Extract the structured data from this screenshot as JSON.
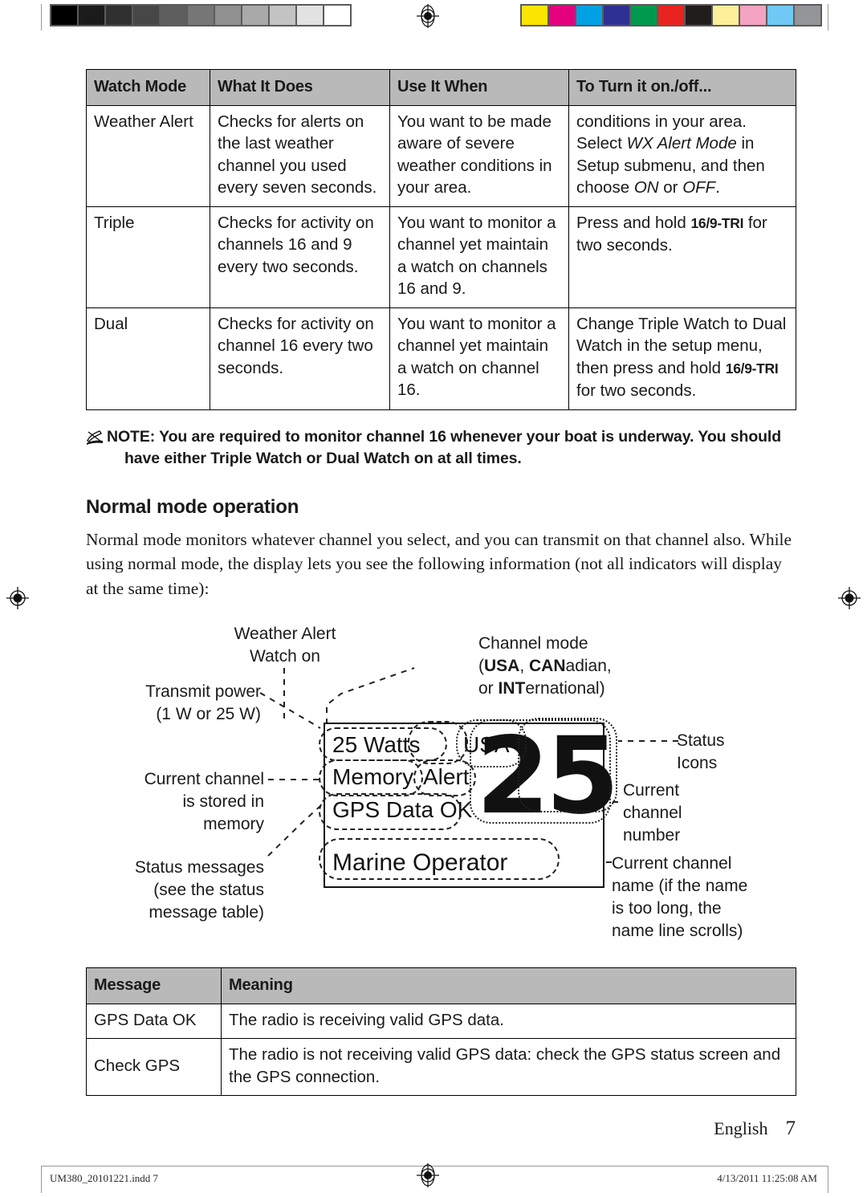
{
  "print_marks": {
    "gray_swatches": [
      "#000000",
      "#1b1b1b",
      "#303030",
      "#474747",
      "#5e5e5e",
      "#767676",
      "#909090",
      "#a9a9a9",
      "#c3c3c3",
      "#e2e2e2",
      "#ffffff"
    ],
    "color_swatches": [
      "#fbe400",
      "#e5007e",
      "#00a0e4",
      "#2e3192",
      "#009a4e",
      "#e8231f",
      "#211d1c",
      "#fdf09a",
      "#f4a3c2",
      "#6fc9f4",
      "#939598"
    ],
    "registration_icon": "registration-target-icon"
  },
  "watch_table": {
    "headers": [
      "Watch Mode",
      "What It Does",
      "Use It When",
      "To Turn it on./off..."
    ],
    "rows": [
      {
        "mode": "Weather Alert",
        "what": "Checks for alerts on the last weather channel you used every seven seconds.",
        "when": "You want to be made aware of severe weather conditions in your area.",
        "howto_pre": "conditions in your area. Select ",
        "howto_italic1": "WX Alert Mode",
        "howto_mid": " in Setup submenu, and then choose ",
        "howto_italic2": "ON",
        "howto_mid2": " or ",
        "howto_italic3": "OFF",
        "howto_post": "."
      },
      {
        "mode": "Triple",
        "what": "Checks for activity on channels 16 and 9 every two seconds.",
        "when": "You want to monitor a channel yet maintain a watch on channels 16 and 9.",
        "howto_pre": "Press and hold ",
        "howto_key": "16/9-TRI",
        "howto_post": " for two seconds."
      },
      {
        "mode": "Dual",
        "what": "Checks for activity on channel 16 every two seconds.",
        "when": "You want to monitor a channel yet maintain a watch on channel 16.",
        "howto_pre": "Change Triple Watch to Dual Watch in the setup menu, then press and hold ",
        "howto_key": "16/9-TRI",
        "howto_post": " for two seconds."
      }
    ]
  },
  "note": {
    "icon": "pencil-note-icon",
    "line1": "NOTE: You are required to monitor channel 16 whenever your boat is underway. You should",
    "line2": "have either Triple Watch or Dual Watch on at all times."
  },
  "section": {
    "title": "Normal mode operation",
    "paragraph": "Normal mode monitors whatever channel you select, and you can transmit on that channel also. While using normal mode, the display lets you see the following information (not all indicators will display at the same time):"
  },
  "diagram": {
    "callouts": {
      "weather_alert_l1": "Weather Alert",
      "weather_alert_l2": "Watch on",
      "channel_mode_l1": "Channel mode",
      "channel_mode_l2_a": "(",
      "channel_mode_l2_b": "USA",
      "channel_mode_l2_c": ", ",
      "channel_mode_l2_d": "CAN",
      "channel_mode_l2_e": "adian,",
      "channel_mode_l3_a": "or ",
      "channel_mode_l3_b": "INT",
      "channel_mode_l3_c": "ernational)",
      "transmit_power_l1": "Transmit power",
      "transmit_power_l2": "(1 W or 25 W)",
      "current_channel_l1": "Current channel",
      "current_channel_l2": "is stored in",
      "current_channel_l3": "memory",
      "status_messages_l1": "Status messages",
      "status_messages_l2": "(see the status",
      "status_messages_l3": "message table)",
      "status_icons_l1": "Status",
      "status_icons_l2": "Icons",
      "channel_number_l1": "Current",
      "channel_number_l2": "channel",
      "channel_number_l3": "number",
      "channel_name_l1": "Current channel",
      "channel_name_l2": "name (if the name",
      "channel_name_l3": "is too long, the",
      "channel_name_l4": "name line scrolls)"
    },
    "lcd": {
      "watts": "25 Watts",
      "mode": "USA",
      "memory": "Memory",
      "alert": "Alert",
      "gps": "GPS Data OK",
      "channel_number": "25",
      "channel_name": "Marine Operator"
    }
  },
  "message_table": {
    "headers": [
      "Message",
      "Meaning"
    ],
    "rows": [
      {
        "message": "GPS Data OK",
        "meaning": "The radio is receiving valid GPS data."
      },
      {
        "message": "Check GPS",
        "meaning": "The radio is not receiving valid GPS data: check the GPS status screen and the GPS connection."
      }
    ]
  },
  "footer": {
    "language": "English",
    "page_number": "7",
    "file_name": "UM380_20101221.indd   7",
    "timestamp": "4/13/2011   11:25:08 AM"
  }
}
